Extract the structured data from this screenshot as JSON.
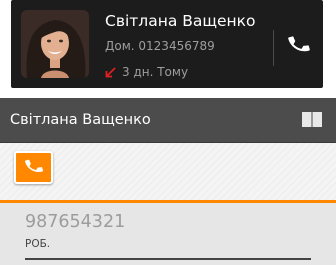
{
  "call_log_item": {
    "contact_name": "Світлана Ващенко",
    "phone": "Дом. 0123456789",
    "time": "3 дн. Тому",
    "call_type_icon": "missed-call-arrow-icon",
    "action_icon": "phone-handset-icon"
  },
  "action_bar": {
    "title": "Світлана Ващенко",
    "book_icon": "book-icon"
  },
  "tabs": {
    "call_tab_icon": "phone-handset-icon"
  },
  "number_entry": {
    "number": "987654321",
    "type": "РОБ."
  },
  "colors": {
    "accent": "#ff8800",
    "missed_call": "#e02020",
    "card_background": "#1c1c1c",
    "action_bar_background": "#4c4c4c"
  }
}
